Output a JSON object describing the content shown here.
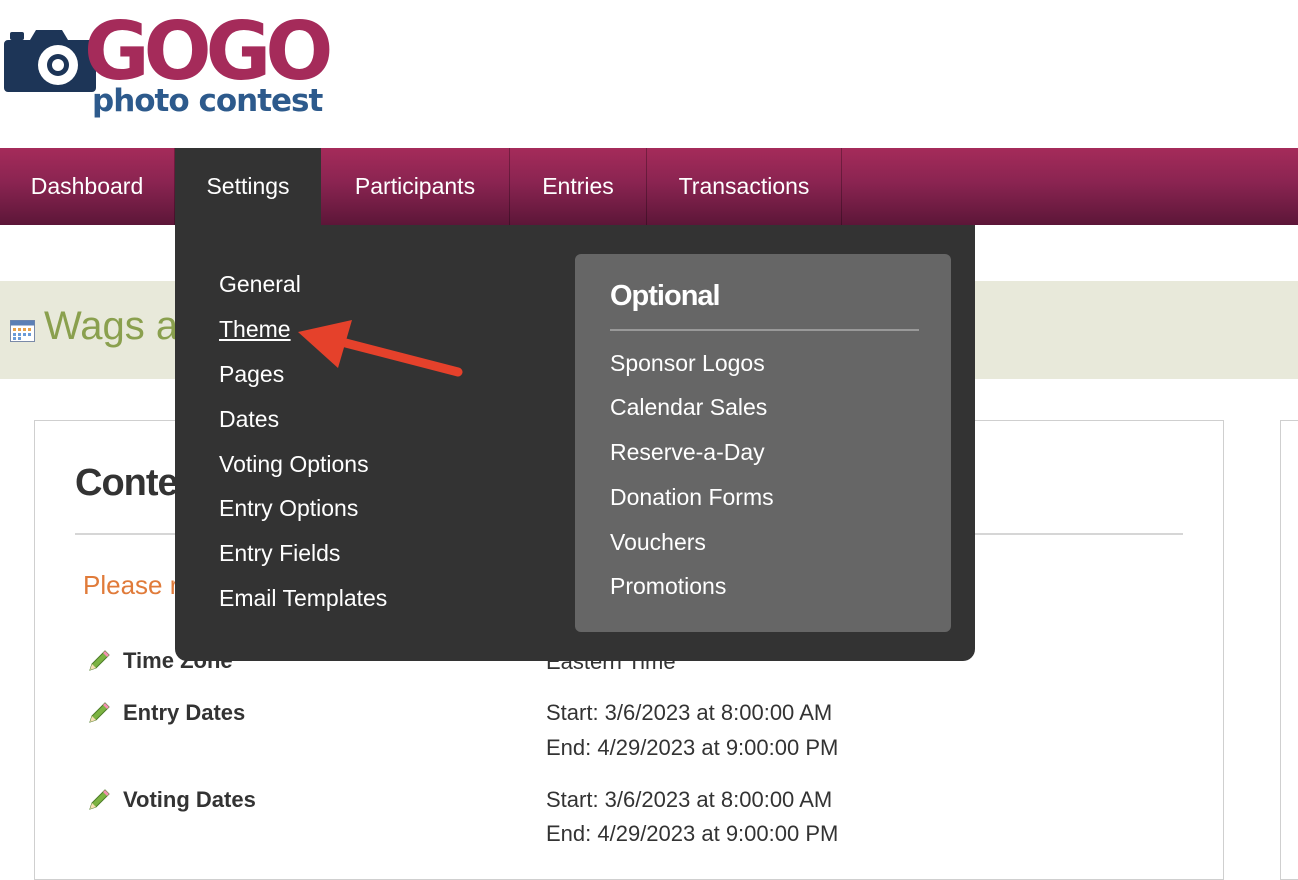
{
  "brand": {
    "name": "GOGO",
    "tagline": "photo contest",
    "colors": {
      "gogo": "#a52b5a",
      "tagline": "#2d5a8c",
      "camera": "#1d3557"
    }
  },
  "nav": {
    "items": [
      {
        "label": "Dashboard"
      },
      {
        "label": "Settings",
        "active": true
      },
      {
        "label": "Participants"
      },
      {
        "label": "Entries"
      },
      {
        "label": "Transactions"
      }
    ]
  },
  "page": {
    "title": "Wags ar",
    "panel_heading": "Conte",
    "notice": "Please r",
    "notice_end": ".",
    "rows": [
      {
        "label": "Time Zone",
        "value": "Eastern Time"
      },
      {
        "label": "Entry Dates",
        "start": "Start: 3/6/2023 at 8:00:00 AM",
        "end": "End: 4/29/2023 at 9:00:00 PM"
      },
      {
        "label": "Voting Dates",
        "start": "Start: 3/6/2023 at 8:00:00 AM",
        "end": "End: 4/29/2023 at 9:00:00 PM"
      }
    ]
  },
  "dropdown": {
    "items": [
      {
        "label": "General"
      },
      {
        "label": "Theme",
        "hovered": true
      },
      {
        "label": "Pages"
      },
      {
        "label": "Dates"
      },
      {
        "label": "Voting Options"
      },
      {
        "label": "Entry Options"
      },
      {
        "label": "Entry Fields"
      },
      {
        "label": "Email Templates"
      }
    ],
    "optional": {
      "title": "Optional",
      "items": [
        {
          "label": "Sponsor Logos"
        },
        {
          "label": "Calendar Sales"
        },
        {
          "label": "Reserve-a-Day"
        },
        {
          "label": "Donation Forms"
        },
        {
          "label": "Vouchers"
        },
        {
          "label": "Promotions"
        }
      ]
    }
  },
  "annotation": {
    "arrow_color": "#e5412b"
  }
}
